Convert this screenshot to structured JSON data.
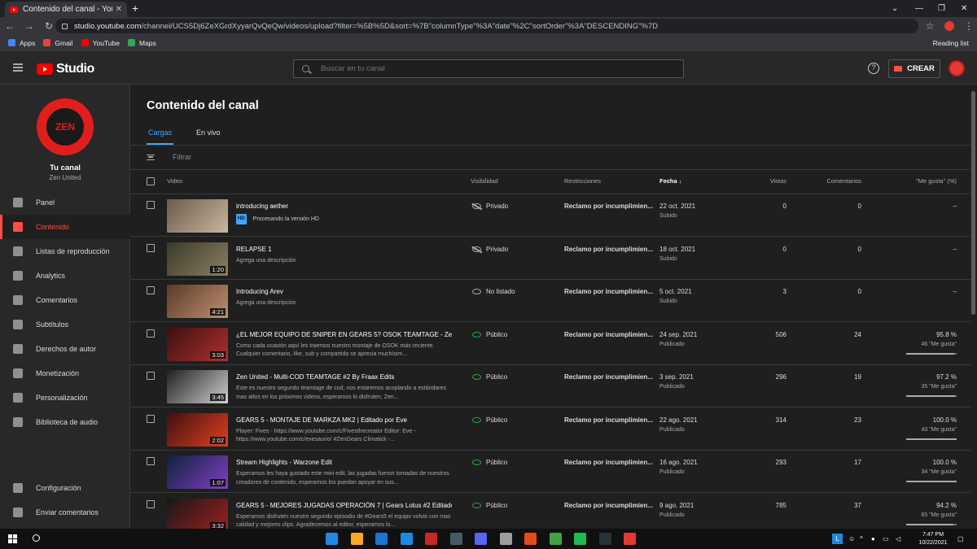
{
  "browser": {
    "tab_title": "Contenido del canal - YouTube S",
    "tab_close": "✕",
    "new_tab": "+",
    "url_host": "studio.youtube.com",
    "url_path": "/channel/UCS5Dj6ZeXGrdXyyarQvQeQw/videos/upload?filter=%5B%5D&sort=%7B\"columnType\"%3A\"date\"%2C\"sortOrder\"%3A\"DESCENDING\"%7D",
    "bookmarks": [
      {
        "label": "Apps",
        "color": "#4285f4"
      },
      {
        "label": "Gmail",
        "color": "#ea4335"
      },
      {
        "label": "YouTube",
        "color": "#ff0000"
      },
      {
        "label": "Maps",
        "color": "#34a853"
      }
    ],
    "reading_list": "Reading list"
  },
  "header": {
    "logo_text": "Studio",
    "search_placeholder": "Buscar en tu canal",
    "help": "?",
    "create_label": "CREAR"
  },
  "sidebar": {
    "channel_logo_text": "ZEN",
    "channel_title": "Tu canal",
    "channel_name": "Zen United",
    "items": [
      {
        "label": "Panel",
        "icon": "dashboard-icon"
      },
      {
        "label": "Contenido",
        "icon": "content-icon",
        "active": true
      },
      {
        "label": "Listas de reproducción",
        "icon": "playlist-icon"
      },
      {
        "label": "Analytics",
        "icon": "analytics-icon"
      },
      {
        "label": "Comentarios",
        "icon": "comments-icon"
      },
      {
        "label": "Subtítulos",
        "icon": "subtitles-icon"
      },
      {
        "label": "Derechos de autor",
        "icon": "copyright-icon"
      },
      {
        "label": "Monetización",
        "icon": "dollar-icon"
      },
      {
        "label": "Personalización",
        "icon": "brush-icon"
      },
      {
        "label": "Biblioteca de audio",
        "icon": "audio-library-icon"
      }
    ],
    "bottom_items": [
      {
        "label": "Configuración",
        "icon": "gear-icon"
      },
      {
        "label": "Enviar comentarios",
        "icon": "feedback-icon"
      }
    ]
  },
  "main": {
    "title": "Contenido del canal",
    "tabs": [
      {
        "label": "Cargas",
        "active": true
      },
      {
        "label": "En vivo",
        "active": false
      }
    ],
    "filter_placeholder": "Filtrar",
    "columns": {
      "video": "Video",
      "visibility": "Visibilidad",
      "restrictions": "Restricciones",
      "date": "Fecha",
      "date_sort_arrow": "↓",
      "views": "Vistas",
      "comments": "Comentarios",
      "likes": "\"Me gusta\" (%)"
    },
    "rows": [
      {
        "title": "introducing aether",
        "desc": "Procesando la versión HD",
        "hd": "HD",
        "duration": "",
        "visibility": "Privado",
        "vis_type": "private",
        "restriction": "Reclamo por incumplimien...",
        "date": "22 oct. 2021",
        "status": "Subido",
        "views": "0",
        "comments": "0",
        "likes": "–",
        "likes_sub": "",
        "likes_fraction": null,
        "thumb": [
          "#6a5a4a",
          "#c8b8a0"
        ]
      },
      {
        "title": "RELAPSE 1",
        "desc": "Agrega una descripción",
        "duration": "1:20",
        "visibility": "Privado",
        "vis_type": "private",
        "restriction": "Reclamo por incumplimien...",
        "date": "18 oct. 2021",
        "status": "Subido",
        "views": "0",
        "comments": "0",
        "likes": "–",
        "likes_sub": "",
        "likes_fraction": null,
        "thumb": [
          "#3a3a2a",
          "#8a8060"
        ]
      },
      {
        "title": "Introducing Arev",
        "desc": "Agrega una descripción",
        "duration": "4:21",
        "visibility": "No listado",
        "vis_type": "unlisted",
        "restriction": "Reclamo por incumplimien...",
        "date": "5 oct. 2021",
        "status": "Subido",
        "views": "3",
        "comments": "0",
        "likes": "–",
        "likes_sub": "",
        "likes_fraction": null,
        "thumb": [
          "#5a3a2a",
          "#c09070"
        ]
      },
      {
        "title": "¿EL MEJOR EQUIPO DE SNIPER EN GEARS 5? OSOK TEAMTAGE - Zen U...",
        "desc": "Como cada ocasión aquí les traemos nuestro montaje de OSOK más reciente. Cualquier comentario, like, sub y compartida se aprecia muchísim...",
        "duration": "3:03",
        "visibility": "Público",
        "vis_type": "public",
        "restriction": "Reclamo por incumplimien...",
        "date": "24 sep. 2021",
        "status": "Publicado",
        "views": "506",
        "comments": "24",
        "likes": "95.8 %",
        "likes_sub": "46 \"Me gusta\"",
        "likes_fraction": 0.958,
        "thumb": [
          "#3a1010",
          "#b03030"
        ]
      },
      {
        "title": "Zen United - Multi-COD TEAMTAGE #2 By Fraax Edits",
        "desc": "Este es nuestro segundo teamtage de cod, nos estaremos acoplando a estándares mas altos en los próximos videos, esperamos lo disfruten, Zen...",
        "duration": "3:45",
        "visibility": "Público",
        "vis_type": "public",
        "restriction": "Reclamo por incumplimien...",
        "date": "3 sep. 2021",
        "status": "Publicado",
        "views": "296",
        "comments": "19",
        "likes": "97.2 %",
        "likes_sub": "35 \"Me gusta\"",
        "likes_fraction": 0.972,
        "thumb": [
          "#202020",
          "#d0d0d0"
        ]
      },
      {
        "title": "GEARS 5 - MONTAJE DE MARKZA MK2 | Editado por Eve",
        "desc": "Player: Fives - https://www.youtube.com/c/Fivesthecreator Editor: Eve - https://www.youtube.com/c/evesaurio/ #ZenGears Climatick -...",
        "duration": "2:02",
        "visibility": "Público",
        "vis_type": "public",
        "restriction": "Reclamo por incumplimien...",
        "date": "22 ago. 2021",
        "status": "Publicado",
        "views": "314",
        "comments": "23",
        "likes": "100.0 %",
        "likes_sub": "43 \"Me gusta\"",
        "likes_fraction": 1.0,
        "thumb": [
          "#401010",
          "#e04020"
        ]
      },
      {
        "title": "Stream Highlights - Warzone Edit",
        "desc": "Esperamos les haya gustado este mini edit, las jugadas fueron tomadas de nuestros creadores de contenido, esperamos los puedan apoyar en sus...",
        "duration": "1:07",
        "visibility": "Público",
        "vis_type": "public",
        "restriction": "Reclamo por incumplimien...",
        "date": "16 ago. 2021",
        "status": "Publicado",
        "views": "293",
        "comments": "17",
        "likes": "100.0 %",
        "likes_sub": "34 \"Me gusta\"",
        "likes_fraction": 1.0,
        "thumb": [
          "#102040",
          "#8040c0"
        ]
      },
      {
        "title": "GEARS 5 - MEJORES JUGADAS OPERACIÓN 7 | Gears Lotus #2 Editado...",
        "desc": "Esperamos disfruten nuestro segundo episodio de #Gears5 el equipo volvió con mas calidad y mejores clips. Agradecemos al editor, esperamos lo...",
        "duration": "3:32",
        "visibility": "Público",
        "vis_type": "public",
        "restriction": "Reclamo por incumplimien...",
        "date": "9 ago. 2021",
        "status": "Publicado",
        "views": "785",
        "comments": "37",
        "likes": "94.2 %",
        "likes_sub": "65 \"Me gusta\"",
        "likes_fraction": 0.942,
        "thumb": [
          "#181818",
          "#a02020"
        ]
      }
    ]
  },
  "taskbar": {
    "apps": [
      "edge-icon",
      "file-explorer-icon",
      "mail-icon",
      "app-l-icon",
      "mcafee-icon",
      "steam-icon",
      "discord-icon",
      "chrome-alt-icon",
      "office-icon",
      "xbox-icon",
      "spotify-icon",
      "next-icon",
      "chrome-icon"
    ],
    "app_colors": [
      "#1e88e5",
      "#f9a825",
      "#1976d2",
      "#1e88e5",
      "#c62828",
      "#455a64",
      "#5865f2",
      "#9e9e9e",
      "#e64a19",
      "#43a047",
      "#1db954",
      "#263238",
      "#e53935"
    ],
    "time": "7:47 PM",
    "date": "10/22/2021",
    "tray_l": "L"
  },
  "colors": {
    "accent_blue": "#3ea6ff",
    "accent_red": "#ff4e45",
    "public_green": "#2ba640"
  }
}
